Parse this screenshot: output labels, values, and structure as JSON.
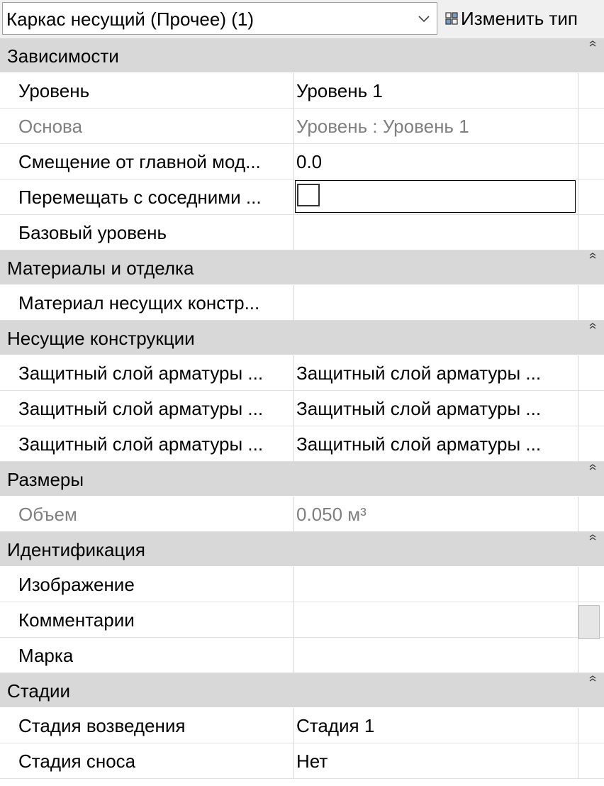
{
  "header": {
    "type_selector": "Каркас несущий (Прочее) (1)",
    "edit_type_label": "Изменить тип"
  },
  "groups": [
    {
      "name": "Зависимости",
      "rows": [
        {
          "name": "Уровень",
          "value": "Уровень 1",
          "readonly": false
        },
        {
          "name": "Основа",
          "value": "Уровень : Уровень 1",
          "readonly": true
        },
        {
          "name": "Смещение от главной мод...",
          "value": "0.0",
          "readonly": false
        },
        {
          "name": "Перемещать с соседними ...",
          "value": "",
          "readonly": false,
          "checkbox": true,
          "checked": false
        },
        {
          "name": "Базовый уровень",
          "value": "",
          "readonly": false
        }
      ]
    },
    {
      "name": "Материалы и отделка",
      "rows": [
        {
          "name": "Материал несущих констр...",
          "value": "",
          "readonly": false
        }
      ]
    },
    {
      "name": "Несущие конструкции",
      "rows": [
        {
          "name": "Защитный слой арматуры ...",
          "value": "Защитный слой арматуры ...",
          "readonly": false
        },
        {
          "name": "Защитный слой арматуры ...",
          "value": "Защитный слой арматуры ...",
          "readonly": false
        },
        {
          "name": "Защитный слой арматуры ...",
          "value": "Защитный слой арматуры ...",
          "readonly": false
        }
      ]
    },
    {
      "name": "Размеры",
      "rows": [
        {
          "name": "Объем",
          "value": "0.050 м³",
          "readonly": true
        }
      ]
    },
    {
      "name": "Идентификация",
      "rows": [
        {
          "name": "Изображение",
          "value": "",
          "readonly": false
        },
        {
          "name": "Комментарии",
          "value": "",
          "readonly": false
        },
        {
          "name": "Марка",
          "value": "",
          "readonly": false
        }
      ]
    },
    {
      "name": "Стадии",
      "rows": [
        {
          "name": "Стадия возведения",
          "value": "Стадия 1",
          "readonly": false
        },
        {
          "name": "Стадия сноса",
          "value": "Нет",
          "readonly": false
        }
      ]
    }
  ],
  "icons": {
    "dropdown": "chevron-down-icon",
    "edit_type": "edit-type-icon",
    "collapse": "collapse-group-icon"
  },
  "colors": {
    "group_header_bg": "#d8d8d8",
    "readonly_text": "#808080",
    "toolbar_bg": "#f0f0f0"
  }
}
